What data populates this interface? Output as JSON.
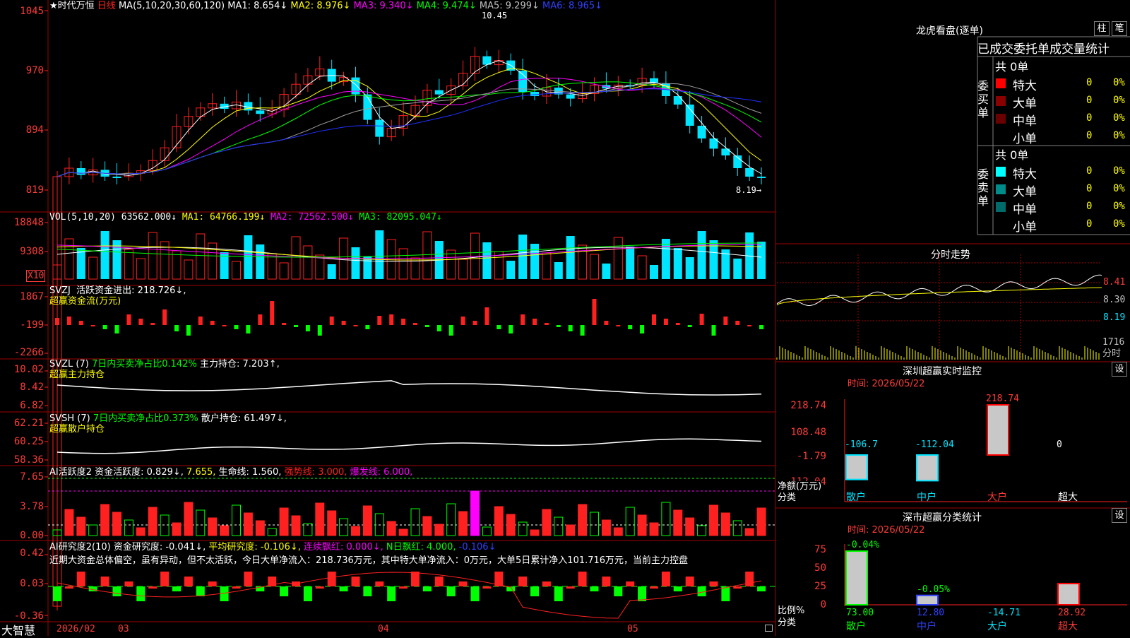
{
  "kline": {
    "header": {
      "star_name": "★时代万恒",
      "period": "日线",
      "ma_param": "MA(5,10,20,30,60,120)",
      "ma1": "MA1: 8.654↓",
      "ma2": "MA2: 8.976↓",
      "ma3": "MA3: 9.340↓",
      "ma4": "MA4: 9.474↓",
      "ma5": "MA5: 9.299↓",
      "ma6": "MA6: 8.965↓"
    },
    "yaxis": [
      "1045",
      "970",
      "894",
      "819"
    ],
    "high_label": "10.45",
    "low_label": "8.19→"
  },
  "vol": {
    "header": {
      "name": "VOL(5,10,20)",
      "value": "63562.000↓",
      "ma1": "MA1: 64766.199↓",
      "ma2": "MA2: 72562.500↓",
      "ma3": "MA3: 82095.047↓"
    },
    "yaxis": [
      "18848",
      "9308"
    ],
    "unit": "X10"
  },
  "svzj": {
    "header": {
      "name": "SVZJ",
      "label": "活跃资金进出: 218.726↓,",
      "sub": "超赢资金流(万元)"
    },
    "yaxis": [
      "1867",
      "-199",
      "-2266"
    ]
  },
  "svzl": {
    "header": {
      "name": "SVZL (7)",
      "ratio": "7日内买卖净占比0.142%",
      "hold": "主力持仓: 7.203↑,",
      "sub": "超赢主力持仓"
    },
    "yaxis": [
      "10.02",
      "8.42",
      "6.82"
    ]
  },
  "svsh": {
    "header": {
      "name": "SVSH (7)",
      "ratio": "7日内买卖净占比0.373%",
      "hold": "散户持仓: 61.497↓,",
      "sub": "超赢散户持仓"
    },
    "yaxis": [
      "62.21",
      "60.25",
      "58.36"
    ]
  },
  "ai_active": {
    "header": {
      "name": "AI活跃度2",
      "active": "资金活跃度: 0.829↓,",
      "v2": "7.655,",
      "life": "生命线: 1.560,",
      "strong": "强势线: 3.000,",
      "burst": "爆发线: 6.000,"
    },
    "yaxis": [
      "7.65",
      "3.78",
      "0.00"
    ]
  },
  "ai_research": {
    "header": {
      "name": "AI研究度2(10)",
      "research": "资金研究度: -0.041↓,",
      "avg": "平均研究度: -0.106↓,",
      "red": "连续飘红: 0.000↓,",
      "nday": "N日飘红: 4.000,",
      "last": "-0.106↓"
    },
    "comment": "近期大资金总体偏空，虽有异动，但不太活跃，今日大单净流入：218.736万元，其中特大单净流入：0万元，大单5日累计净入101.716万元，当前主力控盘",
    "yaxis": [
      "0.42",
      "0.03",
      "-0.36"
    ]
  },
  "bottom": {
    "app": "大智慧",
    "dates": [
      "2026/02",
      "03",
      "04",
      "05"
    ]
  },
  "right": {
    "dragon": {
      "title": "龙虎看盘(逐单)",
      "btn1": "柱",
      "btn2": "笔",
      "subtitle": "已成交委托单成交量统计",
      "buy_total": "共 0单",
      "sell_total": "共 0单",
      "buy_label": [
        "委",
        "买",
        "单"
      ],
      "sell_label": [
        "委",
        "卖",
        "单"
      ],
      "buy_rows": [
        {
          "name": "特大",
          "count": "0",
          "pct": "0%"
        },
        {
          "name": "大单",
          "count": "0",
          "pct": "0%"
        },
        {
          "name": "中单",
          "count": "0",
          "pct": "0%"
        },
        {
          "name": "小单",
          "count": "0",
          "pct": "0%"
        }
      ],
      "sell_rows": [
        {
          "name": "特大",
          "count": "0",
          "pct": "0%"
        },
        {
          "name": "大单",
          "count": "0",
          "pct": "0%"
        },
        {
          "name": "中单",
          "count": "0",
          "pct": "0%"
        },
        {
          "name": "小单",
          "count": "0",
          "pct": "0%"
        }
      ],
      "colors": {
        "buy": [
          "#ff0000",
          "#8b0000",
          "#6a0000",
          "#000000"
        ],
        "sell": [
          "#00ffff",
          "#008b8b",
          "#006b6b",
          "#000000"
        ]
      }
    },
    "intraday": {
      "title": "分时走势",
      "prices": [
        "8.41",
        "8.30",
        "8.19"
      ],
      "vol": "1716",
      "vol_unit": "分时"
    },
    "sz_monitor": {
      "title": "深圳超赢实时监控",
      "btn": "设",
      "time": "时间: 2026/05/22",
      "yaxis": [
        "218.74",
        "108.48",
        "-1.79",
        "-112.04"
      ],
      "ylabel": "净额(万元)",
      "xlabel": "分类",
      "bars": [
        {
          "name": "散户",
          "value": -106.7,
          "label": "-106.7"
        },
        {
          "name": "中户",
          "value": -112.04,
          "label": "-112.04"
        },
        {
          "name": "大户",
          "value": 218.74,
          "label": "218.74"
        },
        {
          "name": "超大",
          "value": 0,
          "label": "0"
        }
      ]
    },
    "sz_class": {
      "title": "深市超赢分类统计",
      "btn": "设",
      "time": "时间: 2026/05/22",
      "yaxis": [
        "75",
        "50",
        "25",
        "0"
      ],
      "ylabel": "比例%",
      "xlabel": "分类",
      "bars": [
        {
          "name": "散户",
          "value": 73.0,
          "label": "73.00",
          "top": "-0.04%"
        },
        {
          "name": "中户",
          "value": 12.8,
          "label": "12.80",
          "top": "-0.05%"
        },
        {
          "name": "大户",
          "value": 0,
          "label": "-14.71",
          "top": ""
        },
        {
          "name": "超大",
          "value": 28.92,
          "label": "28.92",
          "top": ""
        }
      ]
    }
  },
  "colors": {
    "up": "#ff2020",
    "down": "#00e5ff",
    "ma1": "#ffffff",
    "ma2": "#ffff00",
    "ma3": "#ff00ff",
    "ma4": "#00ff00",
    "ma5": "#a0a0a0",
    "ma6": "#2030ff"
  }
}
